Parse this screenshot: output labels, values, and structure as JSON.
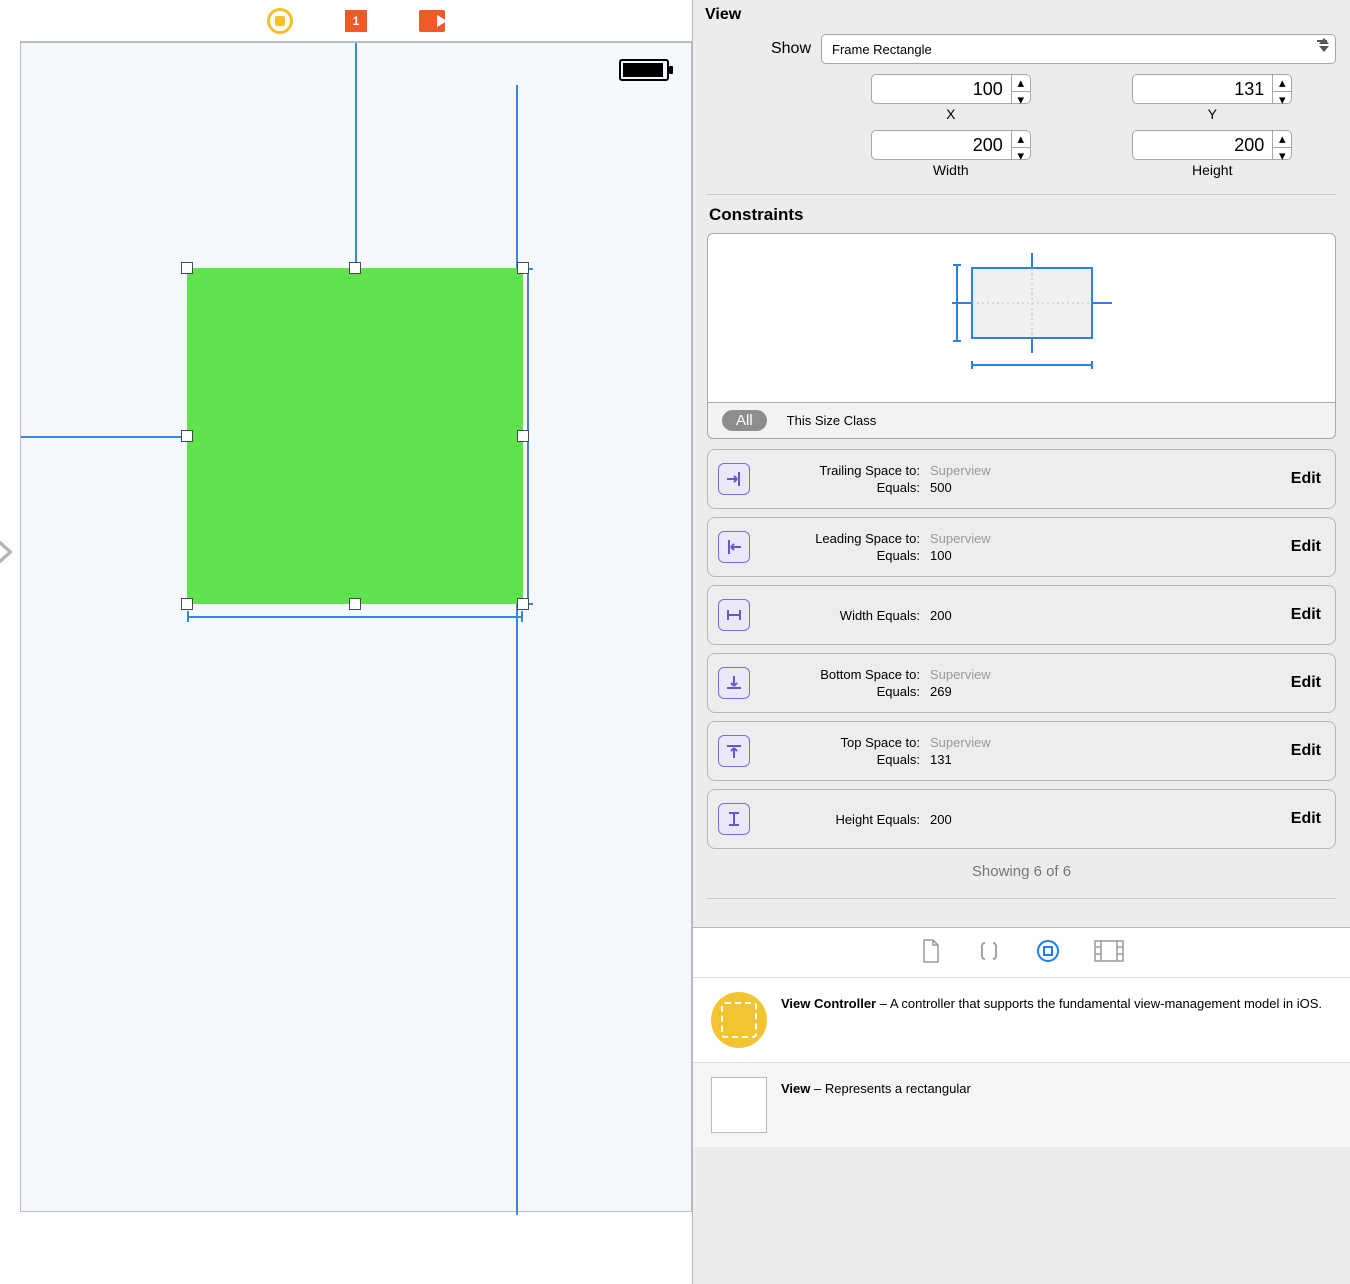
{
  "inspector": {
    "header": "View",
    "show_label": "Show",
    "show_value": "Frame Rectangle",
    "x": {
      "value": "100",
      "label": "X"
    },
    "y": {
      "value": "131",
      "label": "Y"
    },
    "width": {
      "value": "200",
      "label": "Width"
    },
    "height": {
      "value": "200",
      "label": "Height"
    },
    "constraints_header": "Constraints",
    "size_class_all": "All",
    "size_class_label": "This Size Class",
    "showing": "Showing 6 of 6",
    "edit_label": "Edit",
    "items": [
      {
        "k1": "Trailing Space to:",
        "v1": "Superview",
        "k2": "Equals:",
        "v2": "500",
        "dim": true
      },
      {
        "k1": "Leading Space to:",
        "v1": "Superview",
        "k2": "Equals:",
        "v2": "100",
        "dim": true
      },
      {
        "k1": "Width Equals:",
        "v1": "200",
        "single": true
      },
      {
        "k1": "Bottom Space to:",
        "v1": "Superview",
        "k2": "Equals:",
        "v2": "269",
        "dim": true
      },
      {
        "k1": "Top Space to:",
        "v1": "Superview",
        "k2": "Equals:",
        "v2": "131",
        "dim": true
      },
      {
        "k1": "Height Equals:",
        "v1": "200",
        "single": true
      }
    ]
  },
  "library": {
    "vc_title": "View Controller",
    "vc_desc": " – A controller that supports the fundamental view-management model in iOS.",
    "view_title": "View",
    "view_desc": " – Represents a rectangular"
  }
}
